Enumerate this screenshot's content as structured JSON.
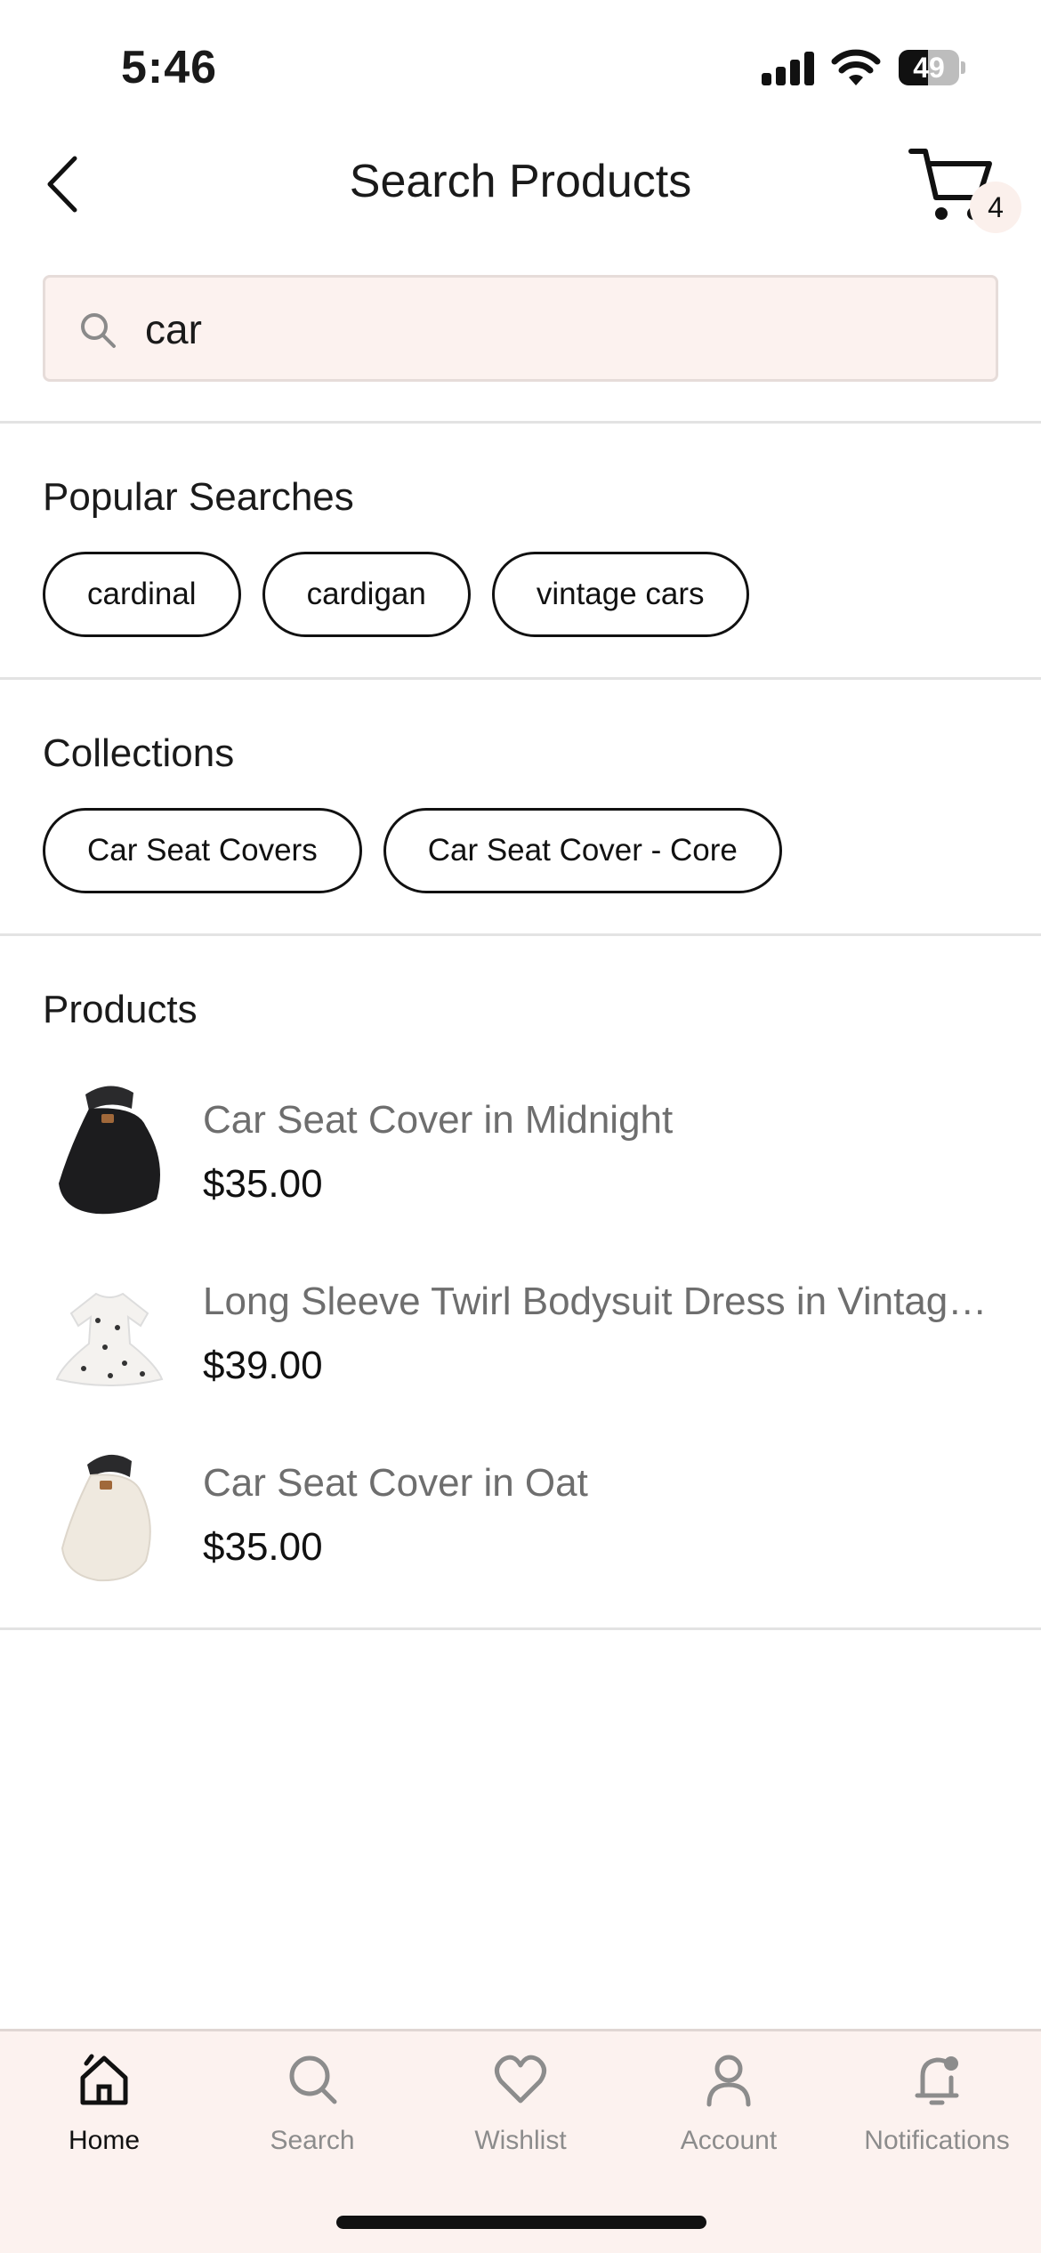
{
  "status_bar": {
    "time": "5:46",
    "battery_percent": "49",
    "battery_level": 0.49
  },
  "header": {
    "title": "Search Products",
    "cart_count": "4"
  },
  "search": {
    "value": "car",
    "placeholder": ""
  },
  "popular_searches": {
    "title": "Popular Searches",
    "items": [
      "cardinal",
      "cardigan",
      "vintage cars"
    ]
  },
  "collections": {
    "title": "Collections",
    "items": [
      "Car Seat Covers",
      "Car Seat Cover - Core"
    ]
  },
  "products": {
    "title": "Products",
    "items": [
      {
        "name": "Car Seat Cover in Midnight",
        "price": "$35.00",
        "thumb_color": "#1c1c1e"
      },
      {
        "name": "Long Sleeve Twirl Bodysuit Dress in Vintage Cars",
        "price": "$39.00",
        "thumb_color": "#f4f2ef"
      },
      {
        "name": "Car Seat Cover in Oat",
        "price": "$35.00",
        "thumb_color": "#efe9df"
      }
    ]
  },
  "tab_bar": {
    "items": [
      {
        "label": "Home",
        "icon": "home-icon",
        "active": true
      },
      {
        "label": "Search",
        "icon": "search-icon",
        "active": false
      },
      {
        "label": "Wishlist",
        "icon": "heart-icon",
        "active": false
      },
      {
        "label": "Account",
        "icon": "person-icon",
        "active": false
      },
      {
        "label": "Notifications",
        "icon": "bell-icon",
        "active": false
      }
    ]
  },
  "colors": {
    "accent_bg": "#fcf2ef",
    "text_primary": "#1a1a1a",
    "text_secondary": "#6e6e6e",
    "tab_inactive": "#8c8c8c"
  }
}
